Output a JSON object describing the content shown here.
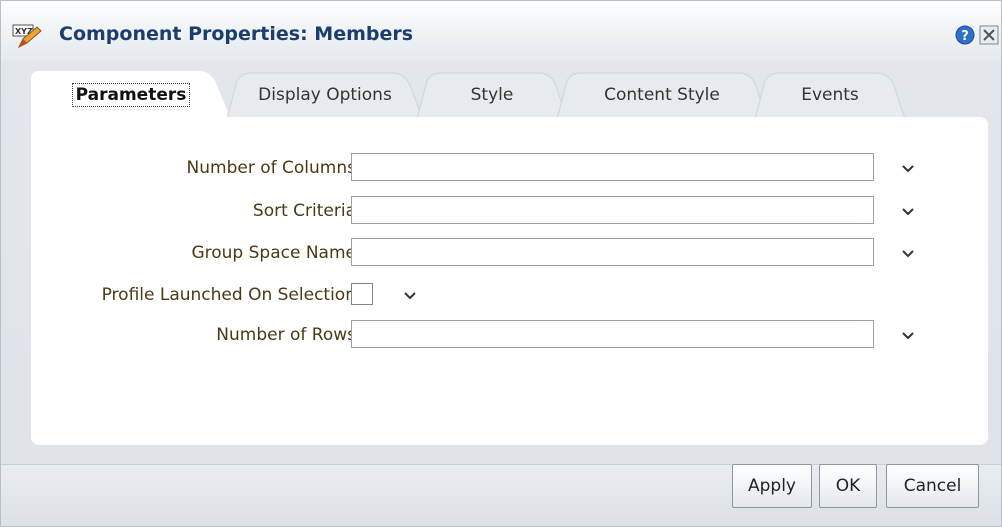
{
  "dialog": {
    "title": "Component Properties: Members",
    "title_icon": "xyz-edit-icon",
    "help_icon": "help-icon",
    "close_icon": "close-icon"
  },
  "tabs": [
    {
      "label": "Parameters",
      "active": true
    },
    {
      "label": "Display Options",
      "active": false
    },
    {
      "label": "Style",
      "active": false
    },
    {
      "label": "Content Style",
      "active": false
    },
    {
      "label": "Events",
      "active": false
    }
  ],
  "fields": {
    "number_of_columns": {
      "label": "Number of Columns",
      "value": ""
    },
    "sort_criteria": {
      "label": "Sort Criteria",
      "value": ""
    },
    "group_space_name": {
      "label": "Group Space Name",
      "value": ""
    },
    "profile_launched_on_selection": {
      "label": "Profile Launched On Selection",
      "checked": false
    },
    "number_of_rows": {
      "label": "Number of Rows",
      "value": ""
    }
  },
  "buttons": {
    "apply": "Apply",
    "ok": "OK",
    "cancel": "Cancel"
  },
  "colors": {
    "title": "#1b3e6e",
    "label": "#4a3a14",
    "help_icon": "#2f6fc4"
  }
}
